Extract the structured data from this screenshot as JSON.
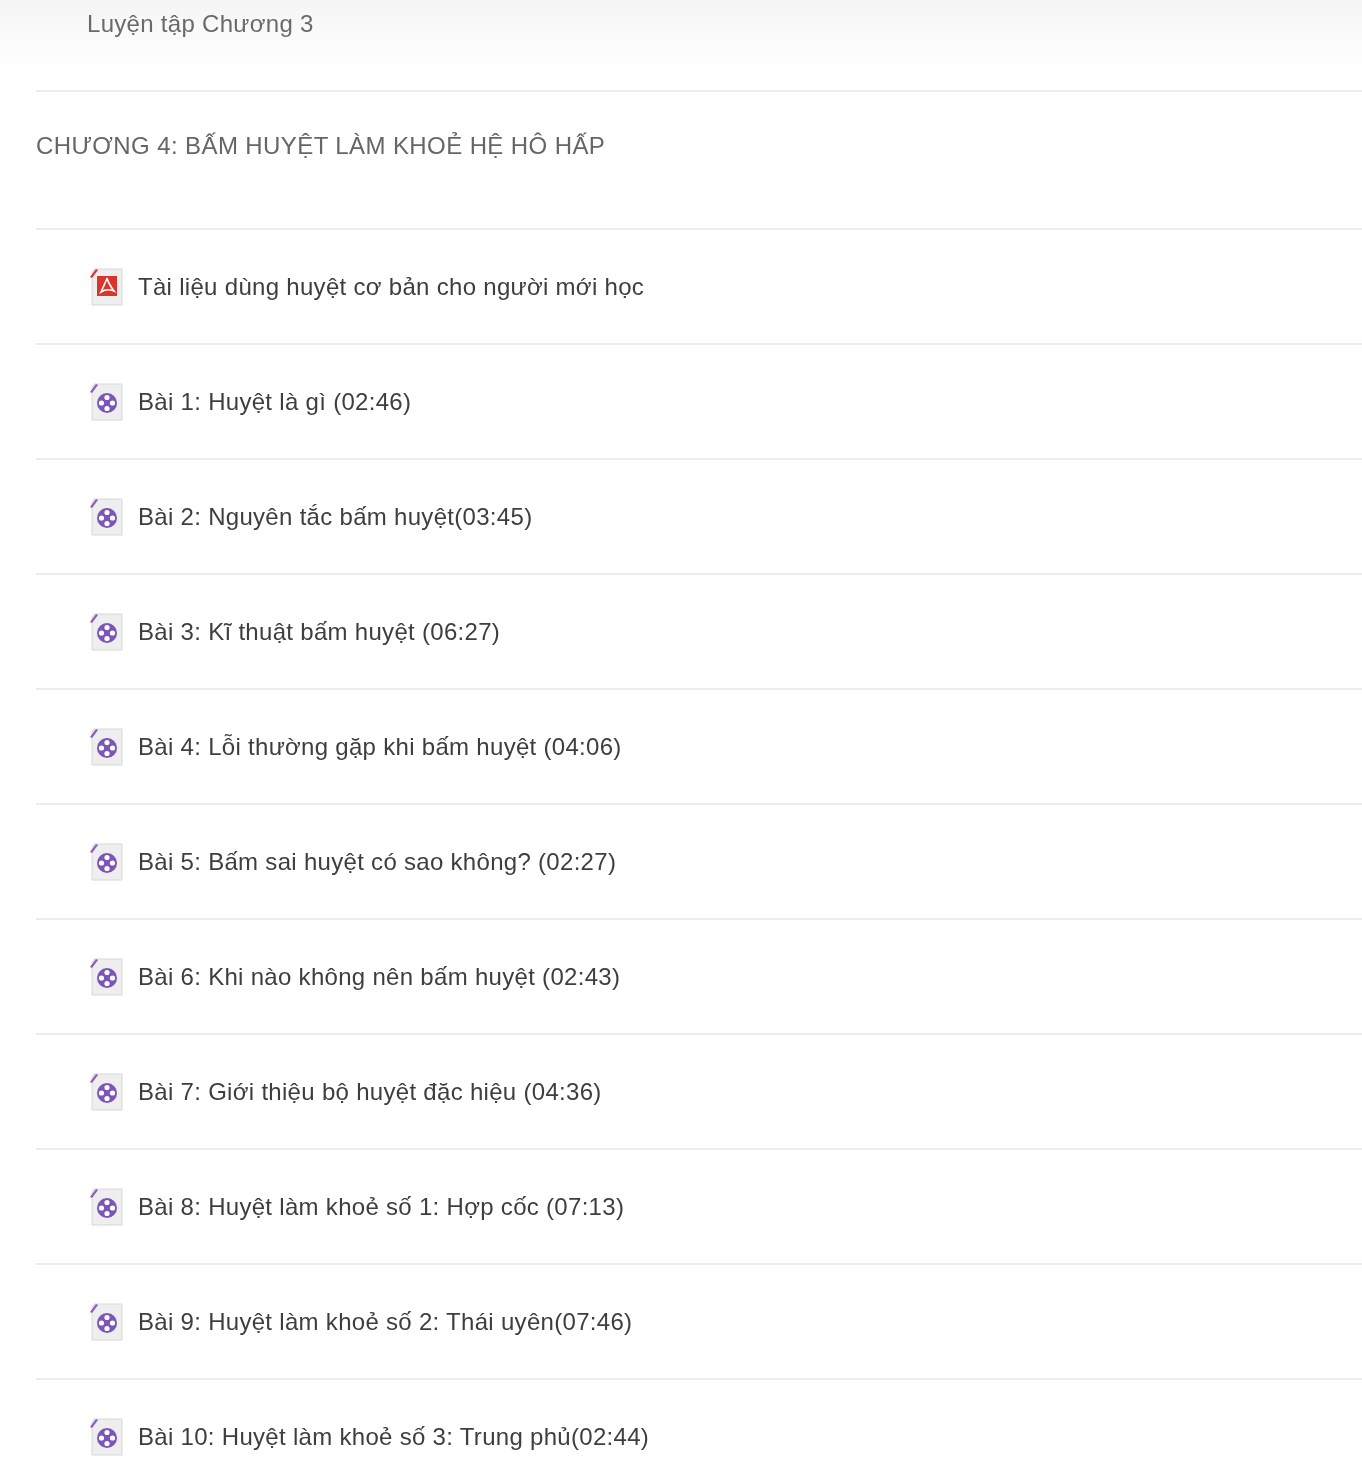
{
  "previous_item": {
    "label": "Luyện tập Chương 3"
  },
  "section": {
    "title": "CHƯƠNG 4: BẤM HUYỆT LÀM KHOẺ HỆ HÔ HẤP",
    "items": [
      {
        "kind": "pdf",
        "label": "Tài liệu dùng huyệt cơ bản cho người mới học"
      },
      {
        "kind": "video",
        "label": "Bài 1: Huyệt là gì (02:46)"
      },
      {
        "kind": "video",
        "label": "Bài 2: Nguyên tắc bấm huyệt(03:45)"
      },
      {
        "kind": "video",
        "label": "Bài 3: Kĩ thuật bấm huyệt (06:27)"
      },
      {
        "kind": "video",
        "label": "Bài 4: Lỗi thường gặp khi bấm huyệt (04:06)"
      },
      {
        "kind": "video",
        "label": "Bài 5: Bấm sai huyệt có sao không? (02:27)"
      },
      {
        "kind": "video",
        "label": "Bài 6: Khi nào không nên bấm huyệt (02:43)"
      },
      {
        "kind": "video",
        "label": "Bài 7: Giới thiệu bộ huyệt đặc hiệu (04:36)"
      },
      {
        "kind": "video",
        "label": "Bài 8: Huyệt làm khoẻ số 1: Hợp cốc (07:13)"
      },
      {
        "kind": "video",
        "label": "Bài 9: Huyệt làm khoẻ số 2: Thái uyên(07:46)"
      },
      {
        "kind": "video",
        "label": "Bài 10: Huyệt làm khoẻ số 3: Trung phủ(02:44)"
      }
    ]
  }
}
